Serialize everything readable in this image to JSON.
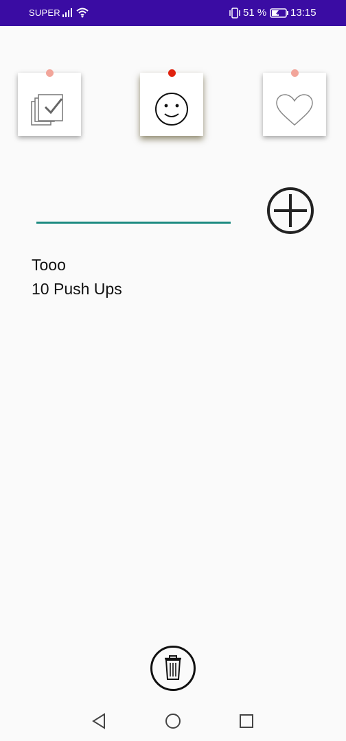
{
  "status_bar": {
    "carrier": "SUPER",
    "battery_percent": "51 %",
    "time": "13:15"
  },
  "tabs": [
    {
      "icon": "checklist-icon",
      "selected": false
    },
    {
      "icon": "smiley-icon",
      "selected": true
    },
    {
      "icon": "heart-icon",
      "selected": false
    }
  ],
  "input": {
    "value": ""
  },
  "todo_items": [
    "Tooo",
    "10 Push Ups"
  ],
  "colors": {
    "status_bar": "#3a0ca3",
    "background": "#fafafa",
    "input_underline": "#1c8a80",
    "pin_active": "#e0220e",
    "pin_inactive": "#f2a59a"
  }
}
